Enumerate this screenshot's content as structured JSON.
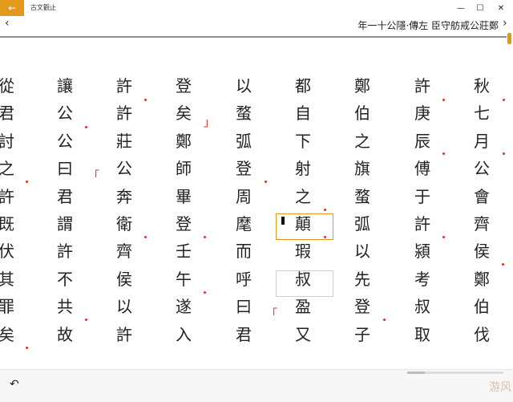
{
  "window": {
    "title": "古文觀止",
    "back_icon": "arrow-left-icon",
    "controls": [
      "—",
      "☐",
      "✕"
    ]
  },
  "nav": {
    "prev": "‹",
    "next": "›",
    "chapter_title": "年一十公隱·傳左 臣守舫戒公莊鄭"
  },
  "columns": [
    {
      "chars": [
        "秋",
        "七",
        "月",
        "公",
        "會",
        "齊",
        "侯",
        "鄭",
        "伯",
        "伐"
      ]
    },
    {
      "chars": [
        "許",
        "庚",
        "辰",
        "傅",
        "于",
        "許",
        "潁",
        "考",
        "叔",
        "取"
      ]
    },
    {
      "chars": [
        "鄭",
        "伯",
        "之",
        "旗",
        "蝥",
        "弧",
        "以",
        "先",
        "登",
        "子"
      ]
    },
    {
      "chars": [
        "都",
        "自",
        "下",
        "射",
        "之",
        "顛",
        "瑕",
        "叔",
        "盈",
        "又"
      ]
    },
    {
      "chars": [
        "以",
        "蝥",
        "弧",
        "登",
        "周",
        "麾",
        "而",
        "呼",
        "曰",
        "君"
      ]
    },
    {
      "chars": [
        "登",
        "矣",
        "鄭",
        "師",
        "畢",
        "登",
        "壬",
        "午",
        "遂",
        "入"
      ]
    },
    {
      "chars": [
        "許",
        "許",
        "莊",
        "公",
        "奔",
        "衛",
        "齊",
        "侯",
        "以",
        "許"
      ]
    },
    {
      "chars": [
        "讓",
        "公",
        "公",
        "曰",
        "君",
        "謂",
        "許",
        "不",
        "共",
        "故"
      ]
    },
    {
      "chars": [
        "從",
        "君",
        "討",
        "之",
        "許",
        "既",
        "伏",
        "其",
        "罪",
        "矣"
      ]
    }
  ],
  "brackets": {
    "open": "「",
    "close": "」"
  },
  "bottom": {
    "undo_icon": "undo-icon",
    "undo_glyph": "↶",
    "progress": 0.18
  },
  "watermark": "游风"
}
